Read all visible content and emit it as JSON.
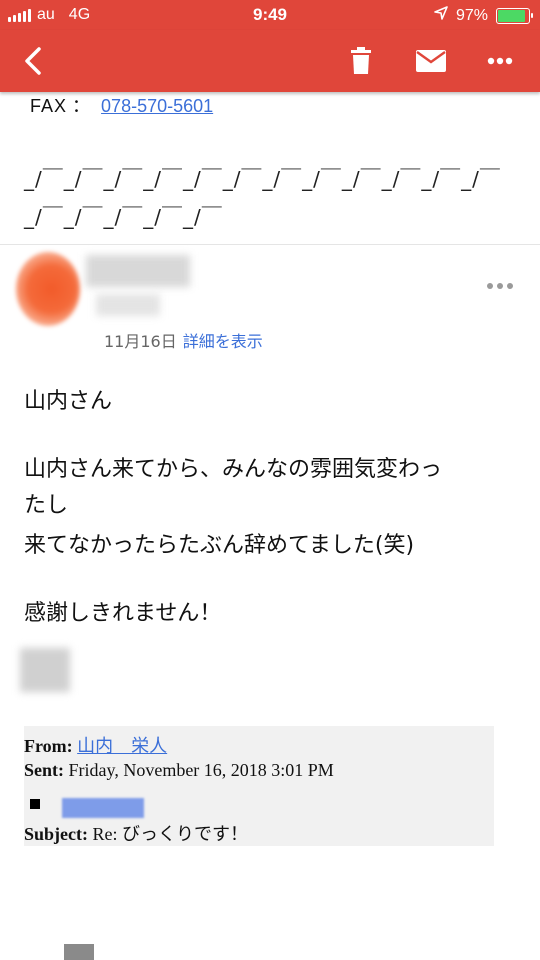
{
  "status_bar": {
    "carrier": "au",
    "network": "4G",
    "time": "9:49",
    "battery": "97%",
    "battery_level": 0.97
  },
  "toolbar": {
    "back_icon": "back-arrow-icon",
    "delete_icon": "trash-icon",
    "mail_icon": "envelope-icon",
    "more_icon": "more-horizontal-icon"
  },
  "previous_message": {
    "fax_label": "FAX",
    "fax_colon": "：",
    "fax_number": "078-570-5601",
    "decoration": "_/￣_/￣_/￣_/￣_/￣_/￣_/￣_/￣_/￣_/￣_/￣_/￣_/￣_/￣_/￣_/￣_/￣"
  },
  "message": {
    "date": "11月16日",
    "details_link": "詳細を表示",
    "lines": [
      "山内さん",
      "山内さん来てから、みんなの雰囲気変わっ",
      "たし",
      "来てなかったらたぶん辞めてました(笑)",
      "感謝しきれません！"
    ]
  },
  "quoted_header": {
    "from_label": "From:",
    "from_value": "山内　栄人",
    "sent_label": "Sent:",
    "sent_value": "Friday, November 16, 2018 3:01 PM",
    "subject_label": "Subject:",
    "subject_value": "Re: びっくりです！"
  },
  "colors": {
    "header_red": "#e0463a",
    "link_blue": "#3b6fd8",
    "battery_green": "#4cd964"
  }
}
